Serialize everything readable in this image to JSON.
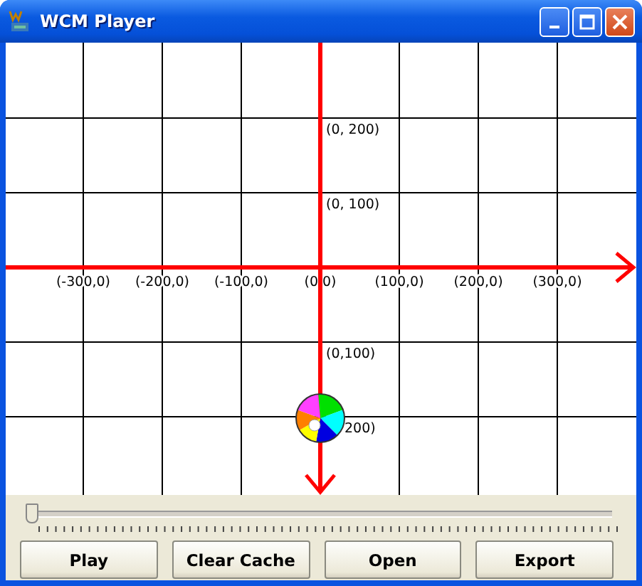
{
  "window": {
    "title": "WCM Player"
  },
  "plot": {
    "x_axis_labels": [
      "(-300,0)",
      "(-200,0)",
      "(-100,0)",
      "(0,0)",
      "(100,0)",
      "(200,0)",
      "(300,0)"
    ],
    "y_axis_labels": [
      "(0, 200)",
      "(0, 100)",
      "(0,100)",
      "200)"
    ]
  },
  "slider": {
    "level": 0
  },
  "buttons": [
    "Play",
    "Clear Cache",
    "Open",
    "Export"
  ]
}
